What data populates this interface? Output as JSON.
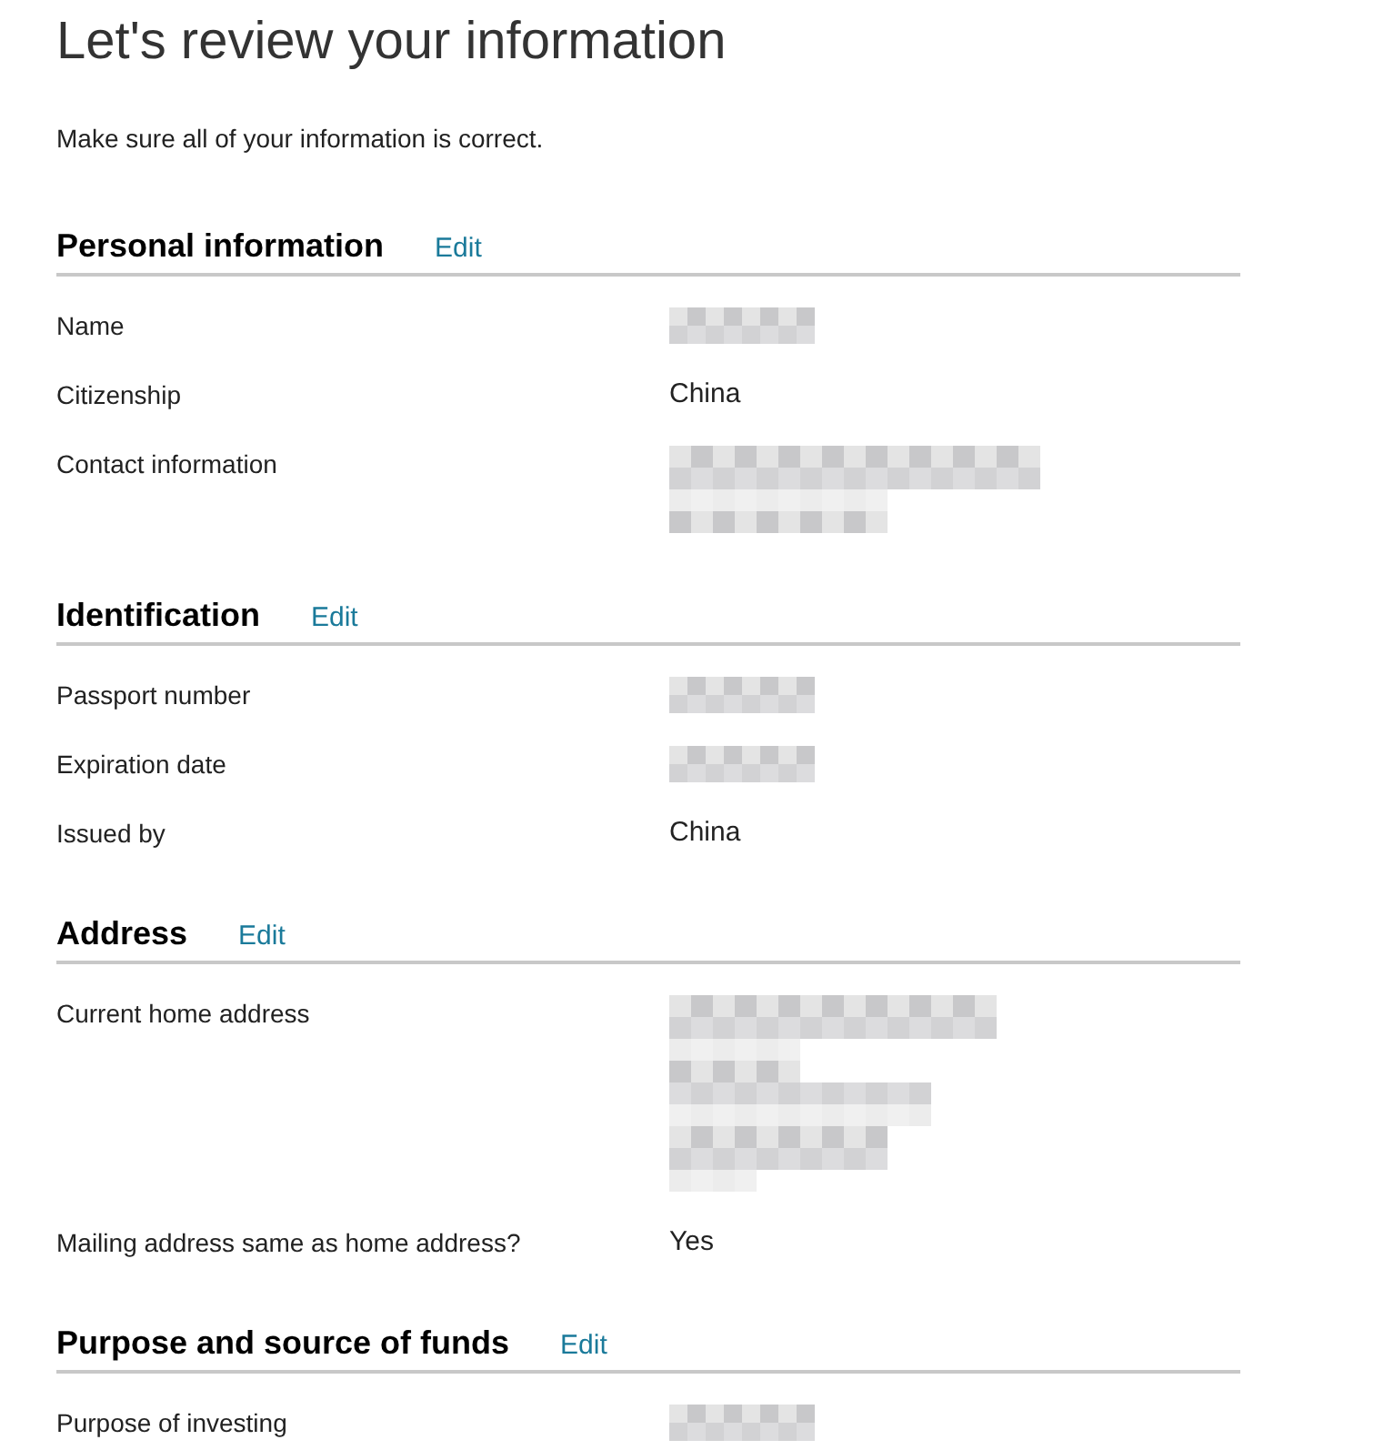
{
  "title": "Let's review your information",
  "subtitle": "Make sure all of your information is correct.",
  "sections": [
    {
      "heading": "Personal information",
      "edit": "Edit",
      "rows": [
        {
          "label": "Name",
          "kind": "redacted"
        },
        {
          "label": "Citizenship",
          "kind": "text",
          "value": "China"
        },
        {
          "label": "Contact information",
          "kind": "redacted_block"
        }
      ]
    },
    {
      "heading": "Identification",
      "edit": "Edit",
      "rows": [
        {
          "label": "Passport number",
          "kind": "redacted"
        },
        {
          "label": "Expiration date",
          "kind": "redacted"
        },
        {
          "label": "Issued by",
          "kind": "text",
          "value": "China"
        }
      ]
    },
    {
      "heading": "Address",
      "edit": "Edit",
      "rows": [
        {
          "label": "Current home address",
          "kind": "redacted_address"
        },
        {
          "label": "Mailing address same as home address?",
          "kind": "text",
          "value": "Yes"
        }
      ]
    },
    {
      "heading": "Purpose and source of funds",
      "edit": "Edit",
      "rows": [
        {
          "label": "Purpose of investing",
          "kind": "redacted"
        }
      ]
    }
  ]
}
